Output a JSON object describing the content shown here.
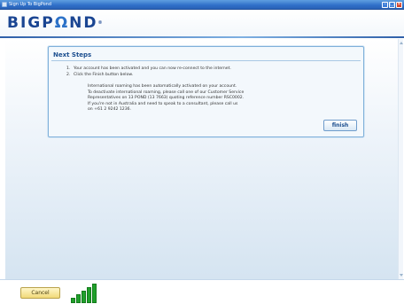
{
  "window": {
    "title": "Sign Up To BigPond",
    "minimize_glyph": "–",
    "maximize_glyph": "□",
    "close_glyph": "✕"
  },
  "brand": {
    "logo_text_big": "BIGP",
    "logo_text_mark": "Ω",
    "logo_text_end": "ND",
    "trademark": "®"
  },
  "next_steps": {
    "title": "Next Steps",
    "steps": [
      {
        "number": "1.",
        "text": "Your account has been activated and you can now re-connect to the internet."
      },
      {
        "number": "2.",
        "text": "Click the Finish button below."
      }
    ],
    "info_lines": [
      "International roaming has been automatically activated on your account.",
      "To deactivate international roaming, please call one of our Customer Service",
      "Representatives on 13 POND (13 7663) quoting reference number RSC0002.",
      "If you're not in Australia and need to speak to a consultant, please call us",
      "on +61 2 9242 1236."
    ],
    "finish_label": "finish"
  },
  "footer": {
    "cancel_label": "Cancel",
    "signal_strength_bars": 5,
    "signal_strength_active": 5
  },
  "colors": {
    "titlebar": "#2f6fc8",
    "brand_blue": "#1a4592",
    "panel_border": "#7fb0da",
    "signal_green": "#1fa02a",
    "cancel_button": "#f1d978"
  },
  "icons": {
    "app_icon": "window-app-icon",
    "signal": "signal-strength-icon"
  }
}
